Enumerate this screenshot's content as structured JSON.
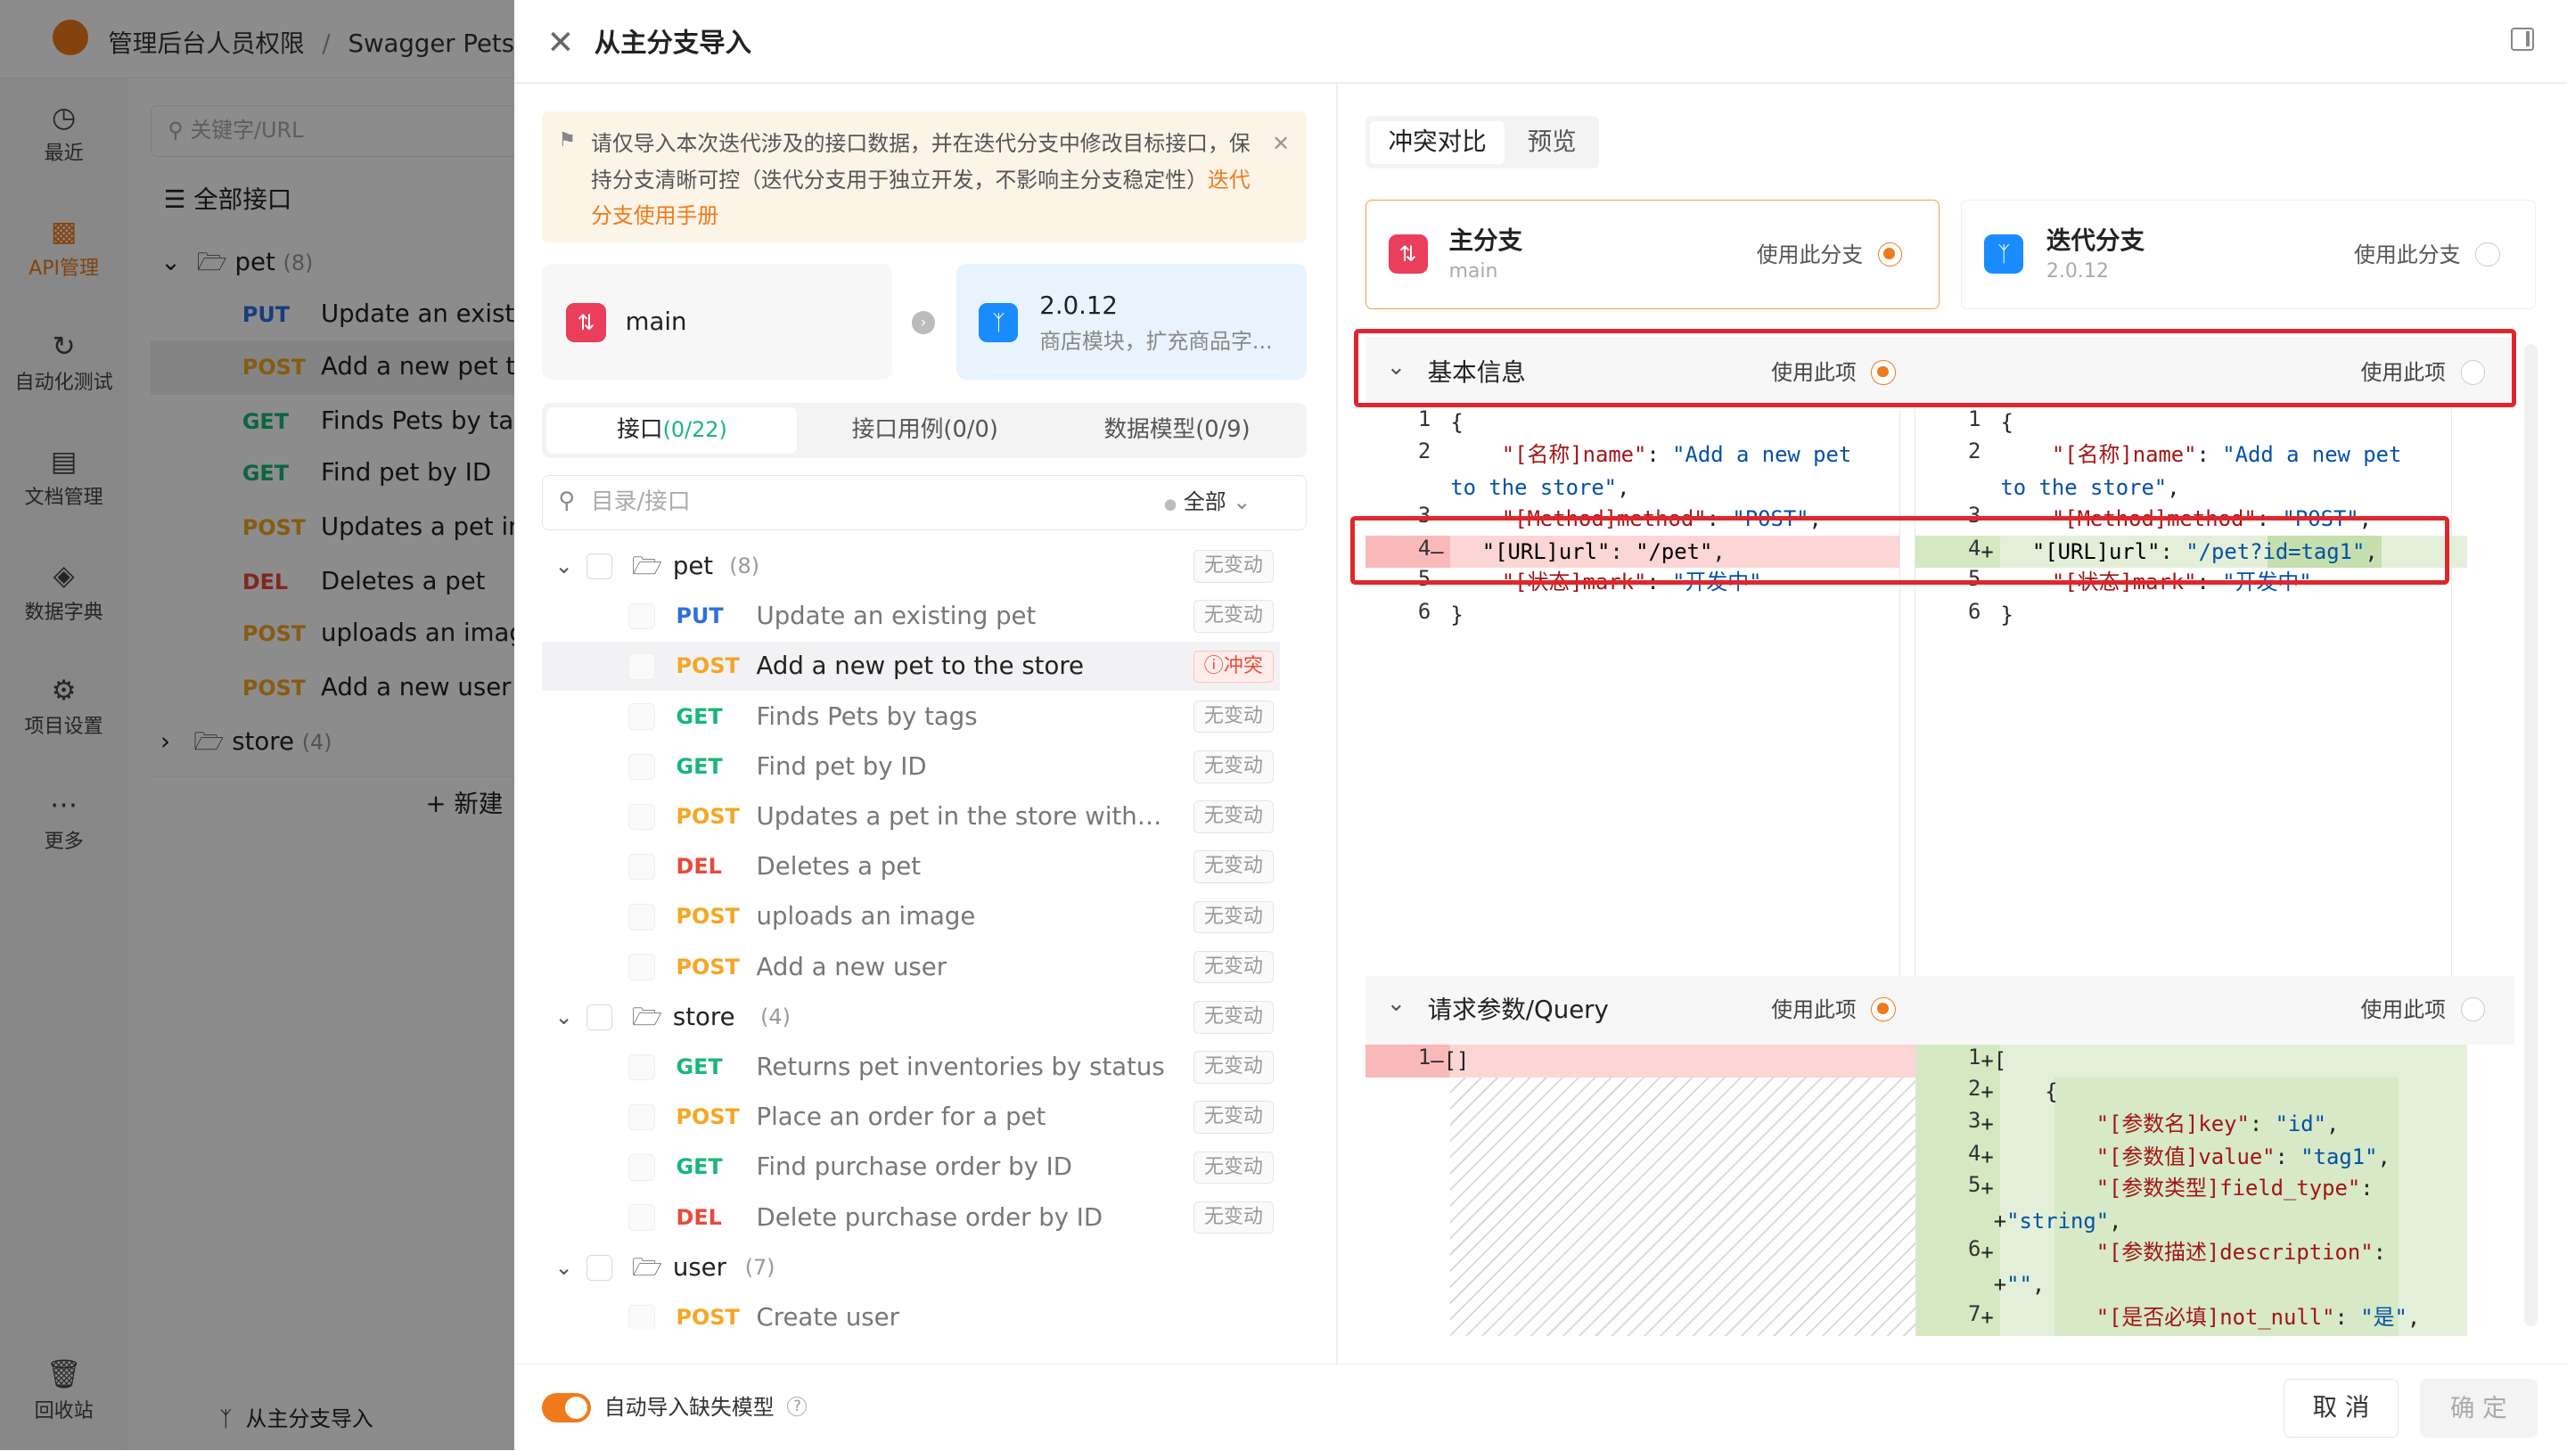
{
  "bg": {
    "breadcrumb": [
      "管理后台人员权限",
      "/",
      "Swagger Petst"
    ],
    "search_placeholder": "关键字/URL",
    "nav": [
      {
        "icon": "clock-icon",
        "label": "最近"
      },
      {
        "icon": "api-icon",
        "label": "API管理"
      },
      {
        "icon": "automation-icon",
        "label": "自动化测试"
      },
      {
        "icon": "doc-icon",
        "label": "文档管理"
      },
      {
        "icon": "data-icon",
        "label": "数据字典"
      },
      {
        "icon": "settings-icon",
        "label": "项目设置"
      },
      {
        "icon": "more-icon",
        "label": "更多"
      },
      {
        "icon": "trash-icon",
        "label": "回收站"
      }
    ],
    "all_api": "全部接口",
    "pet_folder": "pet",
    "pet_count": "(8)",
    "store_folder": "store",
    "store_count": "(4)",
    "rows": [
      {
        "method": "PUT",
        "name": "Update an existir"
      },
      {
        "method": "POST",
        "name": "Add a new pet to"
      },
      {
        "method": "GET",
        "name": "Finds Pets by tag"
      },
      {
        "method": "GET",
        "name": "Find pet by ID"
      },
      {
        "method": "POST",
        "name": "Updates a pet in"
      },
      {
        "method": "DEL",
        "name": "Deletes a pet"
      },
      {
        "method": "POST",
        "name": "uploads an image"
      },
      {
        "method": "POST",
        "name": "Add a new user"
      }
    ],
    "new_btn": "+ 新建",
    "footer_label": "从主分支导入"
  },
  "drawer": {
    "title": "从主分支导入",
    "notice_text": "请仅导入本次迭代涉及的接口数据，并在迭代分支中修改目标接口，保持分支清晰可控（迭代分支用于独立开发，不影响主分支稳定性）",
    "notice_link": "迭代分支使用手册",
    "source_branch": "main",
    "target_branch": "2.0.12",
    "target_desc": "商店模块，扩充商品字...",
    "tabs": [
      {
        "label": "接口",
        "count": "(0/22)"
      },
      {
        "label": "接口用例",
        "count": "(0/0)"
      },
      {
        "label": "数据模型",
        "count": "(0/9)"
      }
    ],
    "search_placeholder": "目录/接口",
    "filter_label": "全部",
    "tree": [
      {
        "type": "folder",
        "name": "pet",
        "count": "(8)",
        "status": "无变动"
      },
      {
        "type": "api",
        "method": "PUT",
        "name": "Update an existing pet",
        "status": "无变动"
      },
      {
        "type": "api",
        "method": "POST",
        "name": "Add a new pet to the store",
        "status": "冲突",
        "conflict": true
      },
      {
        "type": "api",
        "method": "GET",
        "name": "Finds Pets by tags",
        "status": "无变动"
      },
      {
        "type": "api",
        "method": "GET",
        "name": "Find pet by ID",
        "status": "无变动"
      },
      {
        "type": "api",
        "method": "POST",
        "name": "Updates a pet in the store with for...",
        "status": "无变动"
      },
      {
        "type": "api",
        "method": "DEL",
        "name": "Deletes a pet",
        "status": "无变动"
      },
      {
        "type": "api",
        "method": "POST",
        "name": "uploads an image",
        "status": "无变动"
      },
      {
        "type": "api",
        "method": "POST",
        "name": "Add a new user",
        "status": "无变动"
      },
      {
        "type": "folder",
        "name": "store",
        "count": "(4)",
        "status": "无变动"
      },
      {
        "type": "api",
        "method": "GET",
        "name": "Returns pet inventories by status",
        "status": "无变动"
      },
      {
        "type": "api",
        "method": "POST",
        "name": "Place an order for a pet",
        "status": "无变动"
      },
      {
        "type": "api",
        "method": "GET",
        "name": "Find purchase order by ID",
        "status": "无变动"
      },
      {
        "type": "api",
        "method": "DEL",
        "name": "Delete purchase order by ID",
        "status": "无变动"
      },
      {
        "type": "folder",
        "name": "user",
        "count": "(7)",
        "status": ""
      },
      {
        "type": "api",
        "method": "POST",
        "name": "Create user",
        "status": ""
      }
    ],
    "auto_import_label": "自动导入缺失模型",
    "right_tabs": [
      "冲突对比",
      "预览"
    ],
    "main_card": {
      "title": "主分支",
      "sub": "main",
      "use_label": "使用此分支"
    },
    "iter_card": {
      "title": "迭代分支",
      "sub": "2.0.12",
      "use_label": "使用此分支"
    },
    "section_basic": "基本信息",
    "section_query": "请求参数/Query",
    "use_item": "使用此项",
    "cancel": "取 消",
    "confirm": "确 定"
  }
}
